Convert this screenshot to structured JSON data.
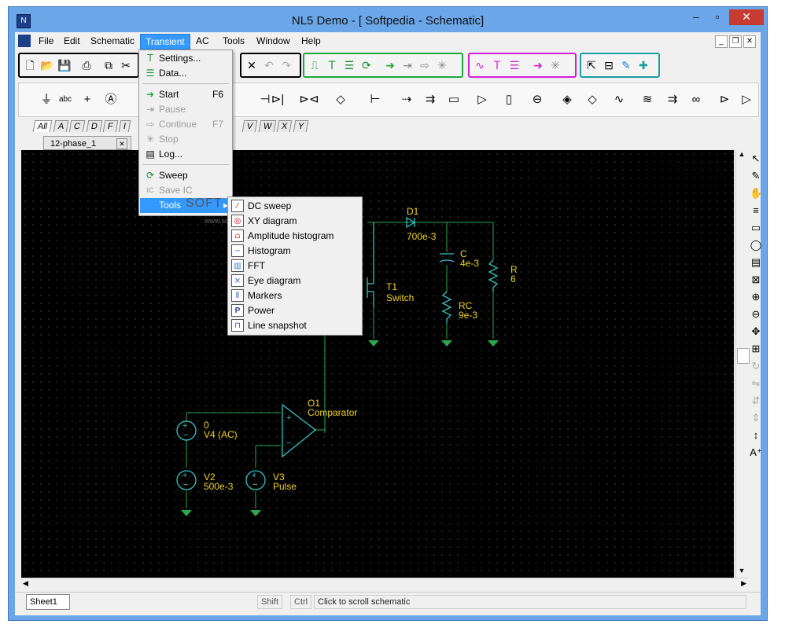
{
  "window": {
    "title": "NL5 Demo - [ Softpedia - Schematic]",
    "icon": "nl5-app-icon"
  },
  "menubar": {
    "items": [
      "File",
      "Edit",
      "Schematic",
      "Transient",
      "AC",
      "Tools",
      "Window",
      "Help"
    ],
    "active": "Transient"
  },
  "component_tabs": [
    "All",
    "A",
    "C",
    "D",
    "F",
    "I",
    "V",
    "W",
    "X",
    "Y"
  ],
  "doc_tab": {
    "label": "12-phase_1"
  },
  "transient_menu": {
    "settings": "Settings...",
    "data": "Data...",
    "start": "Start",
    "start_shortcut": "F6",
    "pause": "Pause",
    "continue": "Continue",
    "continue_shortcut": "F7",
    "stop": "Stop",
    "log": "Log...",
    "sweep": "Sweep",
    "save_ic": "Save IC",
    "tools": "Tools"
  },
  "tools_submenu": [
    "DC sweep",
    "XY diagram",
    "Amplitude histogram",
    "Histogram",
    "FFT",
    "Eye diagram",
    "Markers",
    "Power",
    "Line snapshot"
  ],
  "schematic": {
    "d1_name": "D1",
    "d1_value": "700e-3",
    "c_name": "C",
    "c_value": "4e-3",
    "rc_name": "RC",
    "rc_value": "9e-3",
    "r_name": "R",
    "r_value": "6",
    "t1_name": "T1",
    "t1_value": "Switch",
    "o1_name": "O1",
    "o1_value": "Comparator",
    "v4_name": "0",
    "v4_value": "V4 (AC)",
    "v2_name": "V2",
    "v2_value": "500e-3",
    "v3_name": "V3",
    "v3_value": "Pulse"
  },
  "statusbar": {
    "sheet": "Sheet1",
    "shift": "Shift",
    "ctrl": "Ctrl",
    "message": "Click to scroll schematic"
  },
  "watermark": {
    "logo": "SOFT",
    "url": "www.so"
  },
  "colors": {
    "wire": "#2aa84a",
    "component": "#34c3c3",
    "label": "#f2d21e",
    "canvas": "#000000",
    "menu_highlight": "#3399ff"
  }
}
